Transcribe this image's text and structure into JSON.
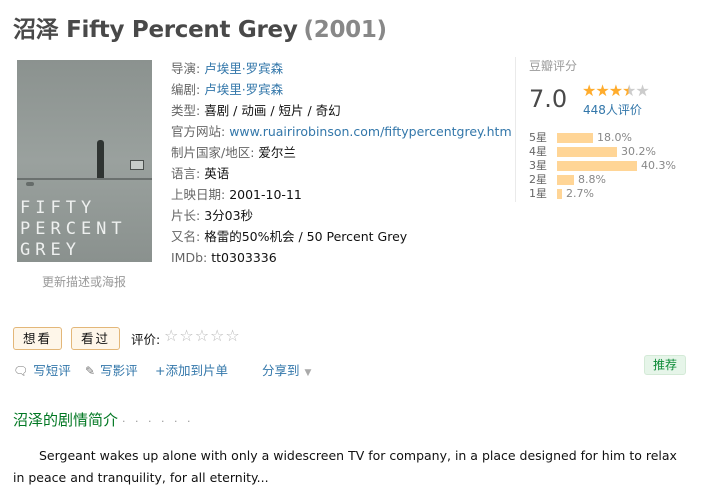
{
  "title": {
    "name": "沼泽 Fifty Percent Grey",
    "year": "(2001)"
  },
  "poster": {
    "text": "FIFTY\nPERCENT\nGREY",
    "update_link": "更新描述或海报"
  },
  "info": {
    "director_label": "导演:",
    "director": "卢埃里·罗宾森",
    "writer_label": "编剧:",
    "writer": "卢埃里·罗宾森",
    "genre_label": "类型:",
    "genre": "喜剧 / 动画 / 短片 / 奇幻",
    "website_label": "官方网站:",
    "website": "www.ruairirobinson.com/fiftypercentgrey.htm",
    "country_label": "制片国家/地区:",
    "country": "爱尔兰",
    "language_label": "语言:",
    "language": "英语",
    "release_label": "上映日期:",
    "release": "2001-10-11",
    "runtime_label": "片长:",
    "runtime": "3分03秒",
    "aka_label": "又名:",
    "aka": "格雷的50%机会 / 50 Percent Grey",
    "imdb_label": "IMDb:",
    "imdb": "tt0303336"
  },
  "rating": {
    "label": "豆瓣评分",
    "score": "7.0",
    "stars": 3.5,
    "votes": "448人评价",
    "distribution": [
      {
        "label": "5星",
        "pct": "18.0%",
        "value": 18.0
      },
      {
        "label": "4星",
        "pct": "30.2%",
        "value": 30.2
      },
      {
        "label": "3星",
        "pct": "40.3%",
        "value": 40.3
      },
      {
        "label": "2星",
        "pct": "8.8%",
        "value": 8.8
      },
      {
        "label": "1星",
        "pct": "2.7%",
        "value": 2.7
      }
    ]
  },
  "actions": {
    "want": "想看",
    "seen": "看过",
    "rate_label": "评价:",
    "short_review": "写短评",
    "review": "写影评",
    "add_list": "+添加到片单",
    "share": "分享到",
    "recommend": "推荐"
  },
  "synopsis": {
    "title": "沼泽的剧情简介",
    "dots": "· · · · · ·",
    "text": "Sergeant wakes up alone with only a widescreen TV for company, in a place designed for him to relax in peace and tranquility, for all eternity..."
  },
  "colors": {
    "link": "#3377aa",
    "accent_green": "#007722",
    "star": "#ffac2d",
    "bar": "#ffd596"
  }
}
